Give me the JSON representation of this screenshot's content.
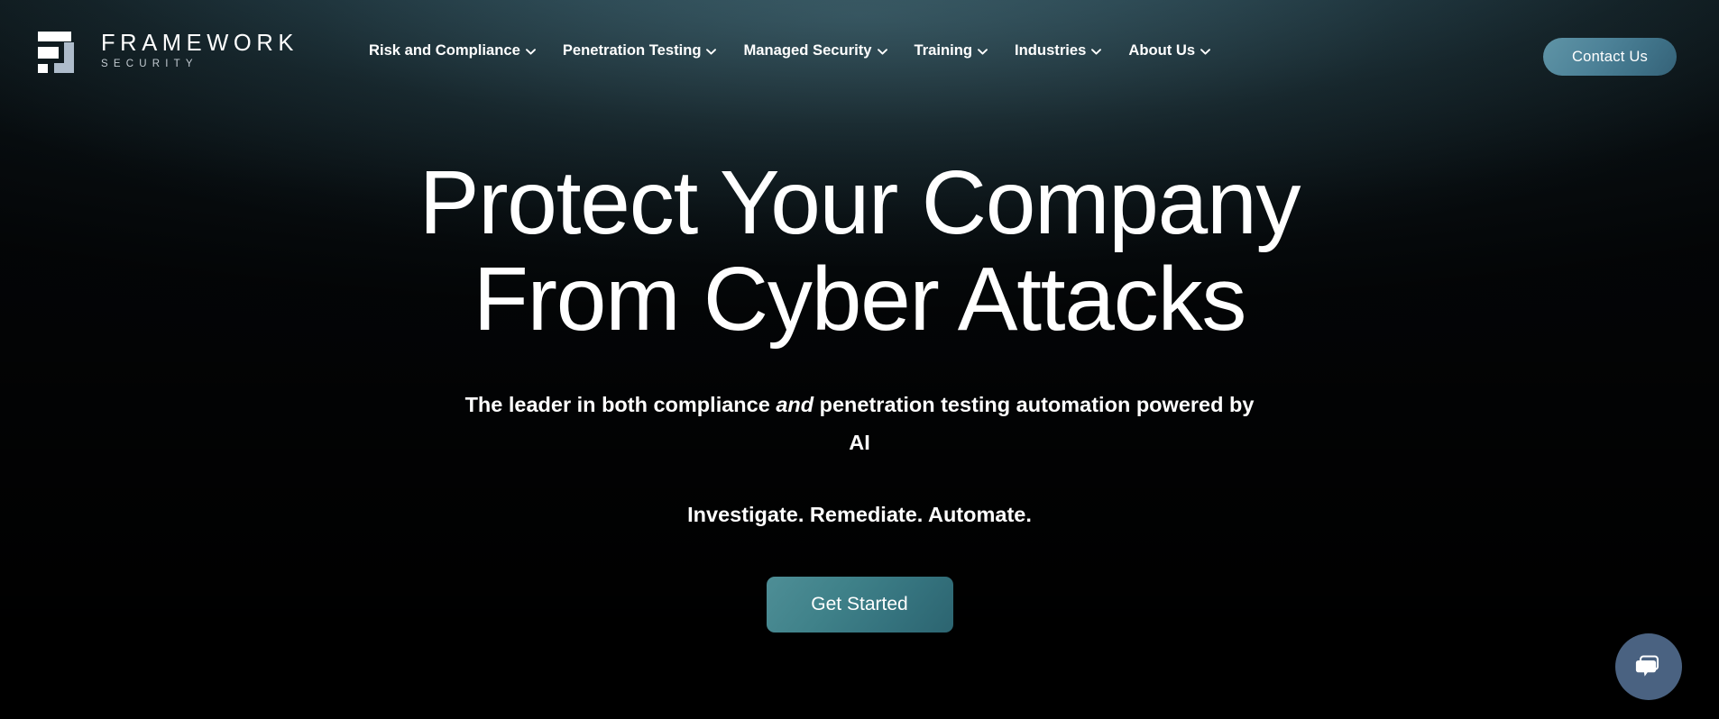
{
  "brand": {
    "name": "FRAMEWORK",
    "subtitle": "SECURITY",
    "logo_icon": "framework-logo-mark",
    "logo_white": "#ffffff",
    "logo_accent": "#aebccb"
  },
  "nav": {
    "items": [
      {
        "label": "Risk and Compliance",
        "icon": "chevron-down-icon",
        "has_dropdown": true
      },
      {
        "label": "Penetration Testing",
        "icon": "chevron-down-icon",
        "has_dropdown": true
      },
      {
        "label": "Managed Security",
        "icon": "chevron-down-icon",
        "has_dropdown": true
      },
      {
        "label": "Training",
        "icon": "chevron-down-icon",
        "has_dropdown": true
      },
      {
        "label": "Industries",
        "icon": "chevron-down-icon",
        "has_dropdown": true
      },
      {
        "label": "About Us",
        "icon": "chevron-down-icon",
        "has_dropdown": true
      }
    ]
  },
  "header": {
    "contact_label": "Contact Us",
    "contact_color": "#4d8298"
  },
  "hero": {
    "headline_line1": "Protect Your Company",
    "headline_line2": "From Cyber Attacks",
    "subhead_before": "The leader in both compliance ",
    "subhead_italic": "and",
    "subhead_after": " penetration testing automation powered by AI",
    "tagline": "Investigate. Remediate. Automate.",
    "cta_label": "Get Started",
    "cta_color": "#3f8189"
  },
  "chat": {
    "icon": "chat-bubble-icon",
    "color": "#4a6281"
  },
  "theme": {
    "background": "#030405",
    "glow": "#3a606c",
    "text": "#ffffff"
  }
}
